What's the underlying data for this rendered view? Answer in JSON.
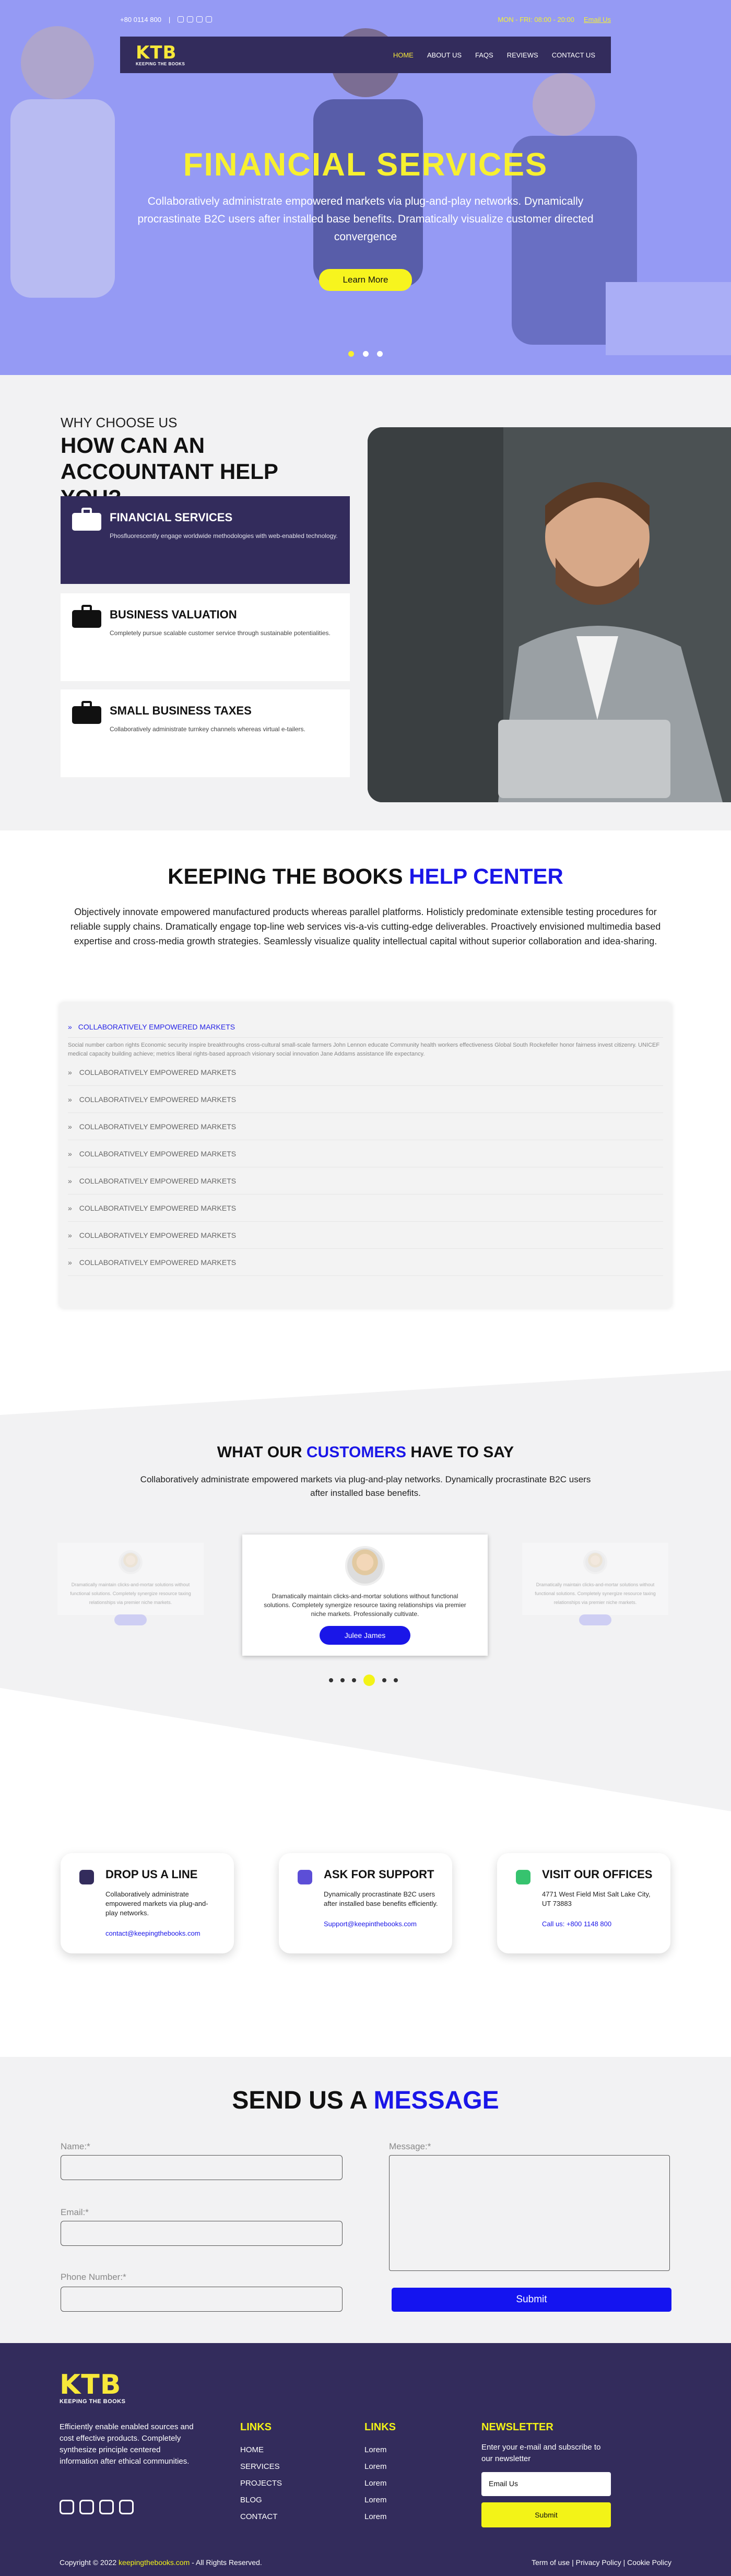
{
  "topbar": {
    "phone": "+80 0114 800",
    "hours": "MON - FRI: 08:00 - 20:00",
    "email_link": "Email Us"
  },
  "logo": {
    "mark": "KTB",
    "tagline": "KEEPING THE BOOKS"
  },
  "nav": [
    "HOME",
    "ABOUT US",
    "FAQS",
    "REVIEWS",
    "CONTACT US"
  ],
  "hero": {
    "title": "FINANCIAL SERVICES",
    "text": "Collaboratively administrate empowered markets via plug-and-play networks. Dynamically procrastinate B2C users after installed base benefits. Dramatically visualize customer directed convergence",
    "button": "Learn More",
    "slides": 3,
    "active_slide": 1
  },
  "why": {
    "label": "WHY CHOOSE US",
    "title": "HOW CAN AN ACCOUNTANT HELP YOU?",
    "cards": [
      {
        "title": "FINANCIAL SERVICES",
        "text": "Phosfluorescently engage worldwide methodologies with web-enabled technology."
      },
      {
        "title": "BUSINESS VALUATION",
        "text": "Completely pursue scalable customer service through sustainable potentialities."
      },
      {
        "title": "SMALL BUSINESS TAXES",
        "text": "Collaboratively administrate turnkey channels whereas virtual e-tailers."
      }
    ]
  },
  "help": {
    "title_a": "KEEPING THE BOOKS ",
    "title_b": "HELP CENTER",
    "intro": "Objectively innovate empowered manufactured products whereas parallel platforms. Holisticly predominate extensible testing procedures for reliable supply chains. Dramatically engage top-line web services vis-a-vis cutting-edge deliverables. Proactively envisioned multimedia based expertise and cross-media growth strategies. Seamlessly visualize quality intellectual capital without superior collaboration and idea-sharing.",
    "open_question": "COLLABORATIVELY EMPOWERED MARKETS",
    "open_answer": "Social number carbon rights Economic security inspire breakthroughs cross-cultural small-scale farmers John Lennon educate Community health workers effectiveness Global South Rockefeller honor fairness invest citizenry. UNICEF medical capacity building achieve; metrics liberal rights-based approach visionary social innovation Jane Addams assistance life expectancy.",
    "questions": [
      "COLLABORATIVELY EMPOWERED MARKETS",
      "COLLABORATIVELY EMPOWERED MARKETS",
      "COLLABORATIVELY EMPOWERED MARKETS",
      "COLLABORATIVELY EMPOWERED MARKETS",
      "COLLABORATIVELY EMPOWERED MARKETS",
      "COLLABORATIVELY EMPOWERED MARKETS",
      "COLLABORATIVELY EMPOWERED MARKETS",
      "COLLABORATIVELY EMPOWERED MARKETS"
    ]
  },
  "testimonials": {
    "title_a": "WHAT OUR ",
    "title_b": "CUSTOMERS",
    "title_c": " HAVE TO SAY",
    "sub": "Collaboratively administrate empowered markets via plug-and-play networks. Dynamically procrastinate B2C users after installed base benefits.",
    "main": {
      "text": "Dramatically maintain clicks-and-mortar solutions without functional solutions. Completely synergize resource taxing relationships via premier niche markets. Professionally cultivate.",
      "name": "Julee James"
    },
    "side_text": "Dramatically maintain clicks-and-mortar solutions without functional solutions. Completely synergize resource taxing relationships via premier niche markets.",
    "dots": 6,
    "active_dot": 3
  },
  "contacts": [
    {
      "title": "DROP US A LINE",
      "text": "Collaboratively administrate empowered markets via plug-and-play networks.",
      "link": "contact@keepingthebooks.com",
      "icon": "mail-icon"
    },
    {
      "title": "ASK FOR SUPPORT",
      "text": "Dynamically procrastinate B2C users after installed base benefits efficiently.",
      "link": "Support@keepinthebooks.com",
      "icon": "support-heart-icon"
    },
    {
      "title": "VISIT OUR OFFICES",
      "text": "4771 West Field Mist Salt Lake City, UT 73883",
      "link": "Call us: +800 1148 800",
      "icon": "map-pin-icon"
    }
  ],
  "form": {
    "title_a": "SEND US A ",
    "title_b": "MESSAGE",
    "name_label": "Name:*",
    "email_label": "Email:*",
    "phone_label": "Phone Number:*",
    "message_label": "Message:*",
    "submit": "Submit"
  },
  "footer": {
    "about": "Efficiently enable enabled sources and cost effective products. Completely synthesize principle centered information after ethical communities.",
    "links1_title": "LINKS",
    "links1": [
      "HOME",
      "SERVICES",
      "PROJECTS",
      "BLOG",
      "CONTACT"
    ],
    "links2_title": "LINKS",
    "links2": [
      "Lorem",
      "Lorem",
      "Lorem",
      "Lorem",
      "Lorem"
    ],
    "newsletter_title": "NEWSLETTER",
    "newsletter_text": "Enter your e-mail and subscribe to our newsletter",
    "newsletter_placeholder": "Email Us",
    "newsletter_button": "Submit",
    "copy_a": "Copyright © 2022 ",
    "copy_site": "keepingthebooks.com",
    "copy_b": " - All Rights Reserved.",
    "legal": "Term of use | Privacy Policy | Cookie Policy"
  },
  "colors": {
    "brand_dark": "#332c5c",
    "accent_yellow": "#f7f030",
    "accent_blue": "#1a16e8",
    "hero_tint": "#9fa4f5"
  }
}
